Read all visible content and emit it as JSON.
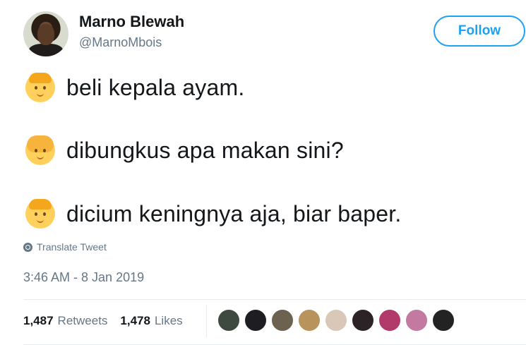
{
  "user": {
    "name": "Marno Blewah",
    "handle": "@MarnoMbois",
    "follow_label": "Follow"
  },
  "tweet": {
    "lines": [
      {
        "emoji": "boy-face-emoji",
        "text": "beli kepala ayam."
      },
      {
        "emoji": "girl-face-emoji",
        "text": "dibungkus apa makan sini?"
      },
      {
        "emoji": "boy-face-emoji",
        "text": "dicium keningnya aja, biar baper."
      }
    ],
    "translate_label": "Translate Tweet",
    "timestamp": "3:46 AM - 8 Jan 2019"
  },
  "stats": {
    "retweets_count": "1,487",
    "retweets_label": "Retweets",
    "likes_count": "1,478",
    "likes_label": "Likes"
  },
  "likers": [
    {
      "color": "#3e4a3f"
    },
    {
      "color": "#1d1d22"
    },
    {
      "color": "#6d6150"
    },
    {
      "color": "#b9935c"
    },
    {
      "color": "#d9c8b7"
    },
    {
      "color": "#2b2326"
    },
    {
      "color": "#b23a6b"
    },
    {
      "color": "#c47aa0"
    },
    {
      "color": "#232323"
    }
  ],
  "colors": {
    "accent": "#1da1f2",
    "secondary_text": "#657786",
    "primary_text": "#14171a"
  }
}
